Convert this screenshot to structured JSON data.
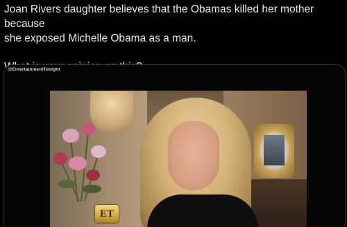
{
  "tweet": {
    "line1": "Joan Rivers daughter believes that the Obamas killed her mother because",
    "line2": "she exposed Michelle Obama as a man.",
    "line3": "What is your opinion on this?"
  },
  "media": {
    "watermark": "@EntertainmentTonight",
    "logo_text": "ET"
  },
  "colors": {
    "background": "#000000",
    "text": "#e7e9ea",
    "card_border": "#2f3336",
    "logo_gold": "#d7b24e"
  }
}
